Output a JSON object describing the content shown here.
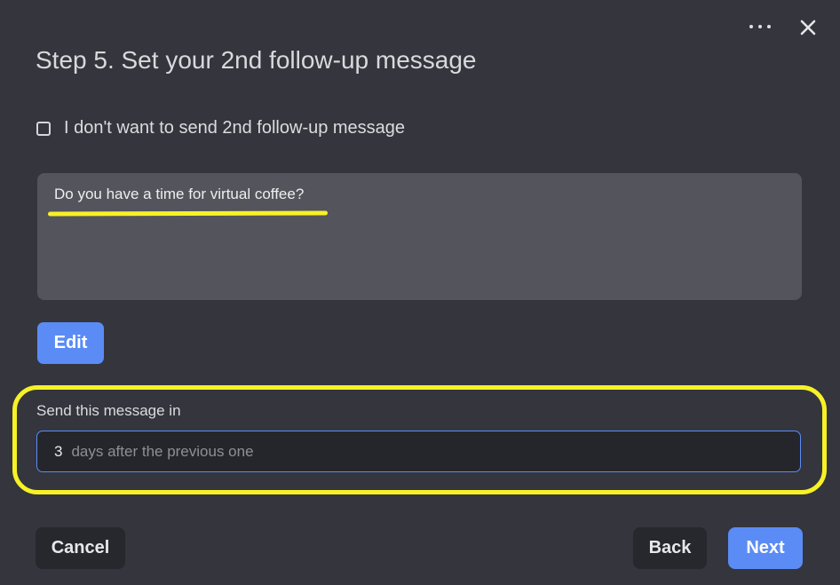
{
  "dialog": {
    "title": "Step 5. Set your 2nd follow-up message",
    "menu_icon": "more-horizontal-icon",
    "close_icon": "close-icon"
  },
  "opt_out": {
    "label": "I don't want to send 2nd follow-up message",
    "checked": false
  },
  "message": {
    "text": "Do you have a time for virtual coffee?"
  },
  "edit_button": {
    "label": "Edit"
  },
  "schedule": {
    "label": "Send this message in",
    "days_value": "3",
    "days_suffix": "days after the previous one"
  },
  "footer": {
    "cancel_label": "Cancel",
    "back_label": "Back",
    "next_label": "Next"
  },
  "colors": {
    "background": "#34353d",
    "accent": "#5b8cf5",
    "message_box": "#54545c",
    "dark_button": "#27282d",
    "annotation_highlight": "#f6f226"
  }
}
